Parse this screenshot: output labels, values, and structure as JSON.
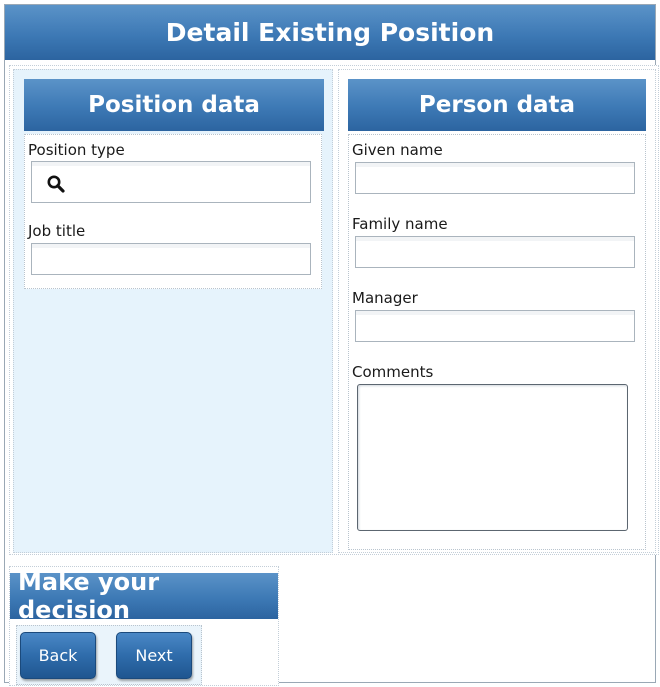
{
  "page": {
    "title": "Detail Existing Position"
  },
  "position_data": {
    "header": "Position data",
    "position_type_label": "Position type",
    "position_type_value": "",
    "job_title_label": "Job title",
    "job_title_value": ""
  },
  "person_data": {
    "header": "Person data",
    "given_name_label": "Given name",
    "given_name_value": "",
    "family_name_label": "Family name",
    "family_name_value": "",
    "manager_label": "Manager",
    "manager_value": "",
    "comments_label": "Comments",
    "comments_value": ""
  },
  "decision": {
    "header": "Make your decision",
    "back_label": "Back",
    "next_label": "Next"
  },
  "icons": {
    "search": "search-icon"
  },
  "colors": {
    "header_blue": "#3d79b5",
    "pane_background": "#e6f3fc",
    "button_blue": "#2f6cab"
  }
}
